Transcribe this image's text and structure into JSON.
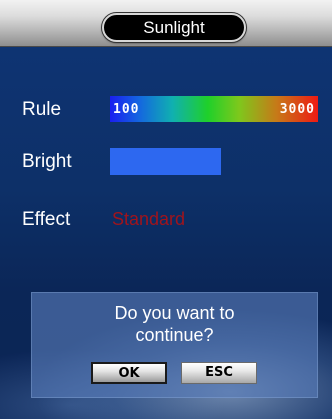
{
  "title": "Sunlight",
  "settings": {
    "rule": {
      "label": "Rule",
      "min": "100",
      "max": "3000"
    },
    "bright": {
      "label": "Bright",
      "color": "#2d68f0"
    },
    "effect": {
      "label": "Effect",
      "value": "Standard",
      "value_color": "#a0141c"
    }
  },
  "dialog": {
    "message_line1": "Do you want to",
    "message_line2": "continue?",
    "ok_label": "OK",
    "esc_label": "ESC"
  }
}
